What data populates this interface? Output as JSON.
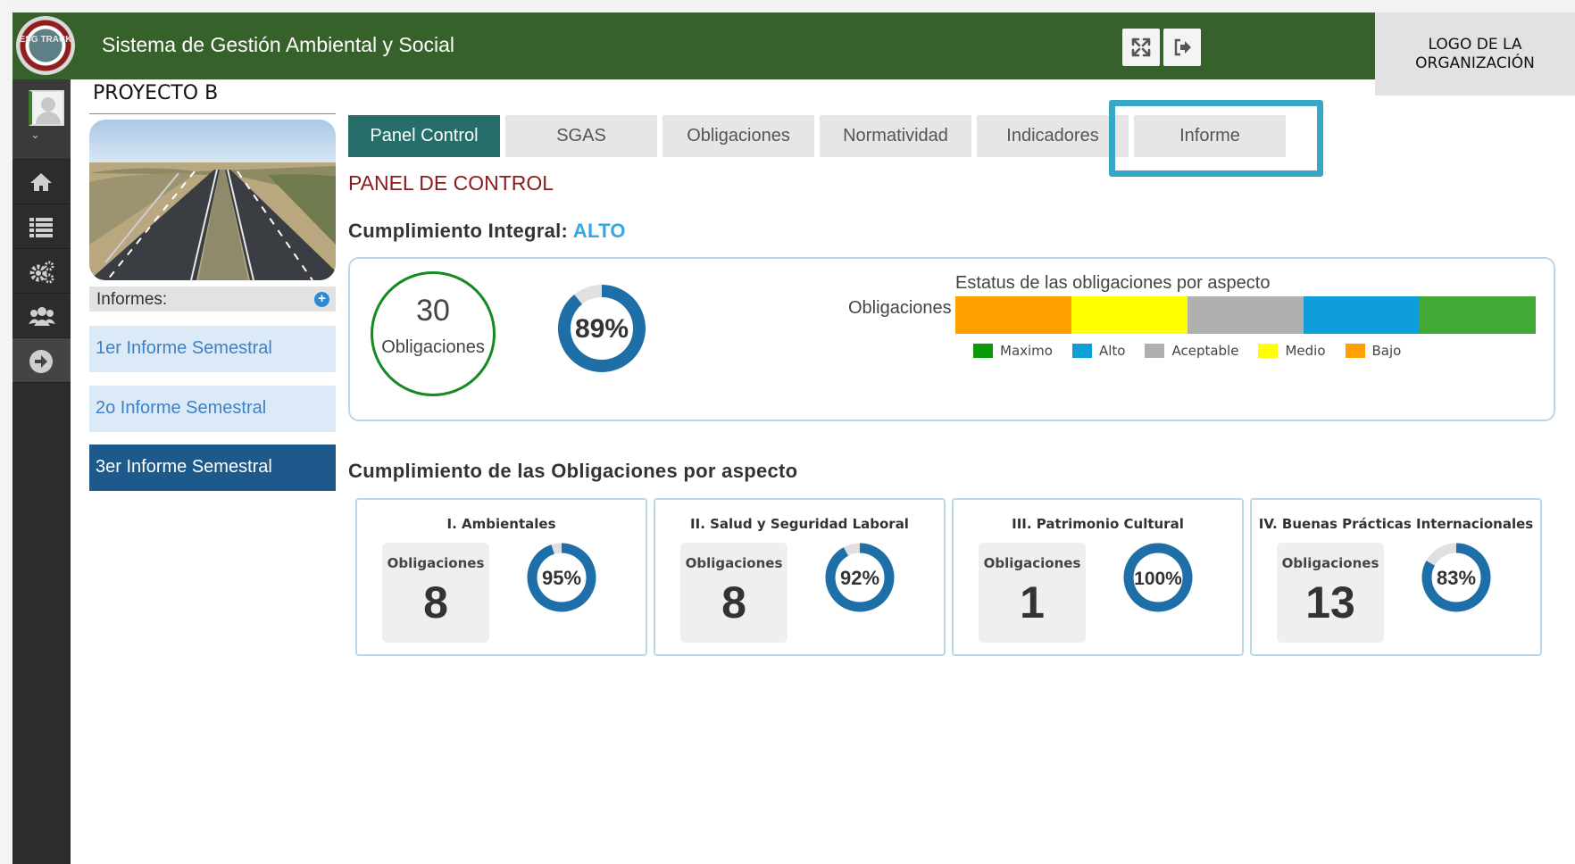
{
  "header": {
    "logo_text": "ESG TRACK",
    "app_title": "Sistema de Gestión Ambiental y Social",
    "expand_icon": "expand-icon",
    "logout_icon": "logout-icon",
    "org_logo_line1": "LOGO DE LA",
    "org_logo_line2": "ORGANIZACIÓN",
    "color": "#37612a"
  },
  "rail": {
    "items": [
      "home-icon",
      "list-icon",
      "settings-icon",
      "users-icon",
      "arrow-right-icon"
    ]
  },
  "project": {
    "title": "PROYECTO  B"
  },
  "side": {
    "informes_label": "Informes:",
    "informes": [
      {
        "label": "1er Informe Semestral"
      },
      {
        "label": "2o Informe Semestral"
      },
      {
        "label": "3er Informe Semestral"
      }
    ],
    "active_index": 2
  },
  "tabs": [
    {
      "label": "Panel Control"
    },
    {
      "label": "SGAS"
    },
    {
      "label": "Obligaciones"
    },
    {
      "label": "Normatividad"
    },
    {
      "label": "Indicadores"
    },
    {
      "label": "Informe"
    }
  ],
  "active_tab": 0,
  "main": {
    "panel_title": "PANEL DE CONTROL",
    "integral_label": "Cumplimiento Integral:",
    "integral_value": "ALTO",
    "total_obligaciones": "30",
    "total_label": "Obligaciones",
    "overall_percent_label": "89%",
    "overall_percent": 0.89,
    "aspects_title": "Cumplimiento de las Obligaciones por aspecto"
  },
  "chart_data": {
    "type": "bar",
    "title": "Estatus de las obligaciones por aspecto",
    "categories": [
      "Obligaciones"
    ],
    "series": [
      {
        "name": "Bajo",
        "color": "#ff9f00",
        "values": [
          1
        ]
      },
      {
        "name": "Medio",
        "color": "#ffff00",
        "values": [
          1
        ]
      },
      {
        "name": "Aceptable",
        "color": "#b0b0b0",
        "values": [
          1
        ]
      },
      {
        "name": "Alto",
        "color": "#109edb",
        "values": [
          1
        ]
      },
      {
        "name": "Maximo",
        "color": "#41a934",
        "values": [
          1
        ]
      }
    ],
    "legend": [
      "Maximo",
      "Alto",
      "Aceptable",
      "Medio",
      "Bajo"
    ],
    "legend_colors": [
      "#0a9a0a",
      "#109edb",
      "#b0b0b0",
      "#ffff00",
      "#ff9f00"
    ],
    "orientation": "horizontal-stacked"
  },
  "aspects": [
    {
      "title": "I. Ambientales",
      "count_label": "Obligaciones",
      "count": "8",
      "percent_label": "95%",
      "percent": 0.95
    },
    {
      "title": "II. Salud y Seguridad Laboral",
      "count_label": "Obligaciones",
      "count": "8",
      "percent_label": "92%",
      "percent": 0.92
    },
    {
      "title": "III. Patrimonio Cultural",
      "count_label": "Obligaciones",
      "count": "1",
      "percent_label": "100%",
      "percent": 1.0
    },
    {
      "title": "IV. Buenas Prácticas Internacionales",
      "count_label": "Obligaciones",
      "count": "13",
      "percent_label": "83%",
      "percent": 0.83
    }
  ],
  "colors": {
    "accent_teal": "#256e6a",
    "highlight": "#38a7c6",
    "donut": "#1e6fa8",
    "title_red": "#8b1b1b"
  }
}
